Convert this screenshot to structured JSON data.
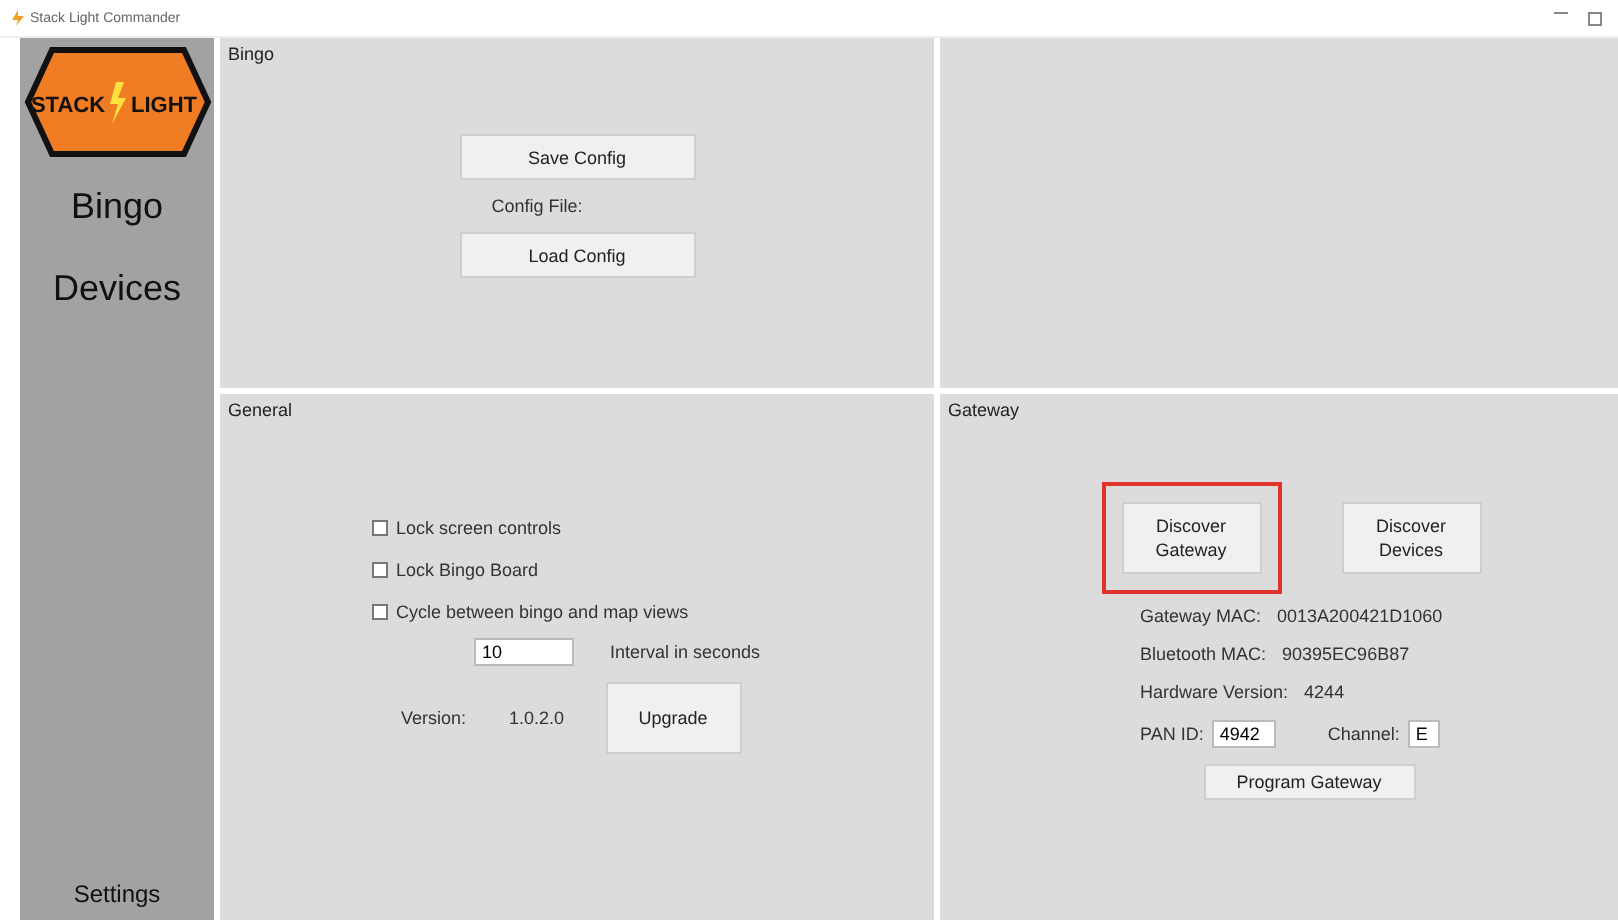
{
  "window": {
    "title": "Stack Light Commander"
  },
  "logo": {
    "left": "STACK",
    "right": "LIGHT"
  },
  "sidebar": {
    "items": [
      {
        "label": "Bingo",
        "selected": false
      },
      {
        "label": "Devices",
        "selected": false
      }
    ],
    "footer": "Settings"
  },
  "bingo_panel": {
    "title": "Bingo",
    "save_button": "Save Config",
    "config_label": "Config File:",
    "load_button": "Load Config"
  },
  "general_panel": {
    "title": "General",
    "options": [
      {
        "label": "Lock screen controls",
        "checked": false
      },
      {
        "label": "Lock Bingo Board",
        "checked": false
      },
      {
        "label": "Cycle between bingo and map views",
        "checked": false
      }
    ],
    "interval": {
      "value": "10",
      "label": "Interval in seconds"
    },
    "version_label": "Version:",
    "version": "1.0.2.0",
    "upgrade_button": "Upgrade"
  },
  "gateway_panel": {
    "title": "Gateway",
    "buttons": [
      {
        "label": "Discover Gateway",
        "highlighted": true
      },
      {
        "label": "Discover Devices",
        "highlighted": false
      }
    ],
    "info": [
      {
        "label": "Gateway MAC:",
        "value": "0013A200421D1060"
      },
      {
        "label": "Bluetooth MAC:",
        "value": "90395EC96B87"
      },
      {
        "label": "Hardware Version:",
        "value": "4244"
      }
    ],
    "pan_id": {
      "label": "PAN ID:",
      "value": "4942"
    },
    "channel": {
      "label": "Channel:",
      "value": "E"
    },
    "program_button": "Program Gateway"
  }
}
